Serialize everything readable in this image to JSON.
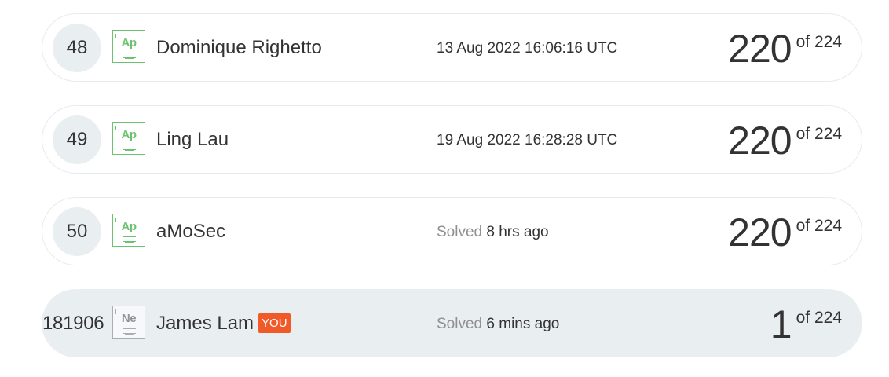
{
  "rows": [
    {
      "rank": "48",
      "badge": "Ap",
      "name": "Dominique Righetto",
      "time_prefix": "",
      "time": "13 Aug 2022 16:06:16 UTC",
      "score": "220",
      "total": "of 224"
    },
    {
      "rank": "49",
      "badge": "Ap",
      "name": "Ling Lau",
      "time_prefix": "",
      "time": "19 Aug 2022 16:28:28 UTC",
      "score": "220",
      "total": "of 224"
    },
    {
      "rank": "50",
      "badge": "Ap",
      "name": "aMoSec",
      "time_prefix": "Solved",
      "time": "8 hrs ago",
      "score": "220",
      "total": "of 224"
    },
    {
      "rank": "181906",
      "badge": "Ne",
      "name": "James Lam",
      "you_tag": "YOU",
      "time_prefix": "Solved",
      "time": "6 mins ago",
      "score": "1",
      "total": "of 224"
    }
  ],
  "colors": {
    "badge_green": "#6cc26f",
    "badge_grey": "#a9aeb2",
    "you_tag": "#f05a28",
    "highlight_row": "#e9eef1"
  }
}
